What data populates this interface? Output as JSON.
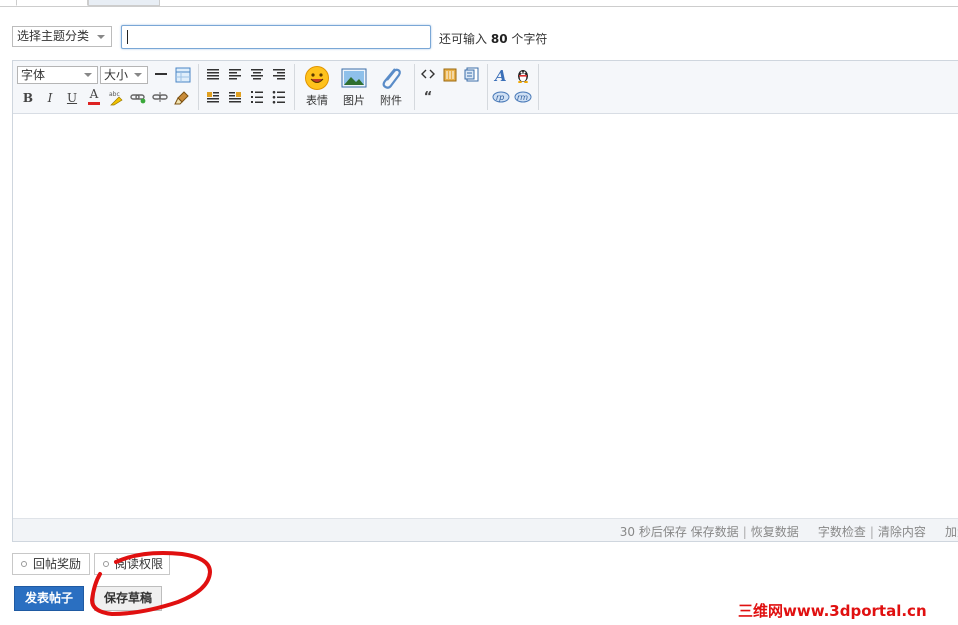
{
  "subject": {
    "type_select": "选择主题分类",
    "remain_prefix": "还可输入",
    "remain_count": "80",
    "remain_suffix": "个字符",
    "input_value": ""
  },
  "toolbar": {
    "font_label": "字体",
    "size_label": "大小",
    "emoticon_label": "表情",
    "image_label": "图片",
    "attach_label": "附件",
    "bold": "B",
    "italic": "I",
    "underline": "U",
    "fontcolor": "A",
    "quote": "“",
    "code": "<>"
  },
  "statusbar": {
    "autosave": "30 秒后保存",
    "save_data": "保存数据",
    "restore_data": "恢复数据",
    "word_check": "字数检查",
    "clear_content": "清除内容",
    "add": "加大"
  },
  "options": {
    "reply_reward": "回帖奖励",
    "read_perm": "阅读权限"
  },
  "actions": {
    "submit": "发表帖子",
    "save_draft": "保存草稿"
  },
  "watermark": "三维网www.3dportal.cn",
  "colors": {
    "submit_bg": "#2a6fc1",
    "annotation": "#e01010"
  }
}
